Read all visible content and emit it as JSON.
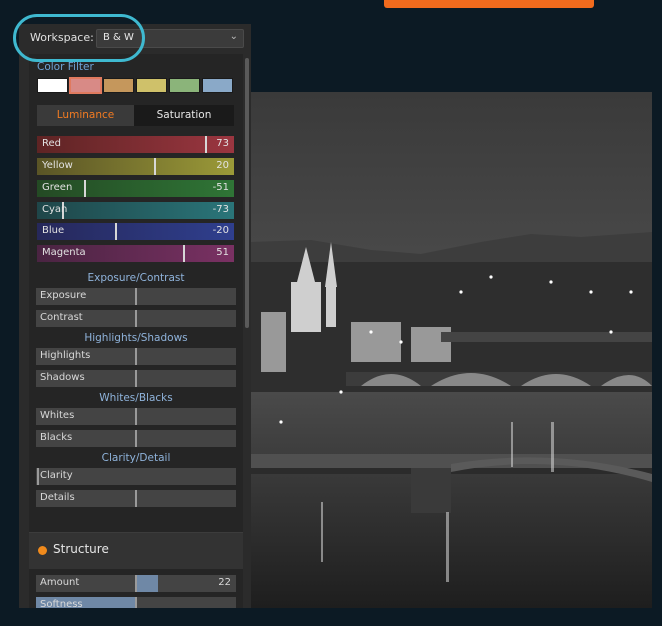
{
  "workspace": {
    "label": "Workspace:",
    "value": "B & W"
  },
  "color_filter": {
    "title": "Color Filter",
    "swatches": [
      "#ffffff",
      "#d88a86",
      "#c5975c",
      "#cfc16a",
      "#8bb47a",
      "#8aa9c8"
    ],
    "selected_index": 1
  },
  "tabs": {
    "luminance": "Luminance",
    "saturation": "Saturation"
  },
  "color_sliders": [
    {
      "label": "Red",
      "value": "73",
      "gradient": [
        "#5e2424",
        "#9b3640"
      ]
    },
    {
      "label": "Yellow",
      "value": "20",
      "gradient": [
        "#5a5426",
        "#9b9a38"
      ]
    },
    {
      "label": "Green",
      "value": "-51",
      "gradient": [
        "#244a24",
        "#2f7536"
      ]
    },
    {
      "label": "Cyan",
      "value": "-73",
      "gradient": [
        "#1f4649",
        "#2a7579"
      ]
    },
    {
      "label": "Blue",
      "value": "-20",
      "gradient": [
        "#26285a",
        "#2f3f8e"
      ]
    },
    {
      "label": "Magenta",
      "value": "51",
      "gradient": [
        "#4a2442",
        "#7a3163"
      ]
    }
  ],
  "color_slider_positions": [
    0.86,
    0.6,
    0.24,
    0.13,
    0.4,
    0.75
  ],
  "exposure_contrast": {
    "title": "Exposure/Contrast",
    "exposure": "Exposure",
    "contrast": "Contrast"
  },
  "highlights_shadows": {
    "title": "Highlights/Shadows",
    "highlights": "Highlights",
    "shadows": "Shadows"
  },
  "whites_blacks": {
    "title": "Whites/Blacks",
    "whites": "Whites",
    "blacks": "Blacks"
  },
  "clarity_detail": {
    "title": "Clarity/Detail",
    "clarity": "Clarity",
    "details": "Details"
  },
  "structure": {
    "title": "Structure",
    "amount_label": "Amount",
    "amount_value": "22",
    "softness_label": "Softness"
  },
  "colors": {
    "accent": "#f27b22",
    "highlight_ring": "#3fb9d0",
    "blue_heading": "#8fb3db"
  }
}
